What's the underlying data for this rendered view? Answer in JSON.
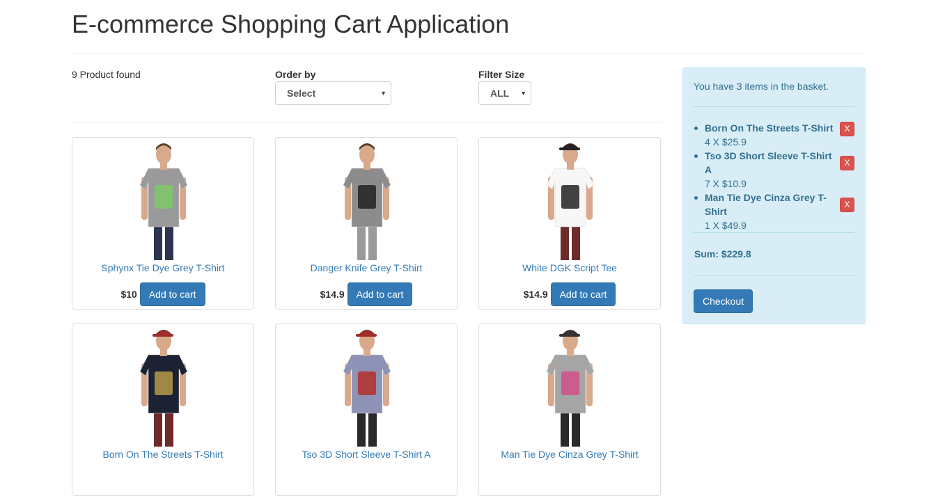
{
  "page": {
    "title": "E-commerce Shopping Cart Application"
  },
  "filters": {
    "count_text": "9 Product found",
    "order_label": "Order by",
    "order_value": "Select",
    "size_label": "Filter Size",
    "size_value": "ALL"
  },
  "products": [
    {
      "name": "Sphynx Tie Dye Grey T-Shirt",
      "price": "$10",
      "button": "Add to cart",
      "shirt": "#9a9a9a",
      "pants": "#2b3550",
      "hat": "",
      "print": "#7cc96a"
    },
    {
      "name": "Danger Knife Grey T-Shirt",
      "price": "$14.9",
      "button": "Add to cart",
      "shirt": "#8c8c8c",
      "pants": "#9a9a9a",
      "hat": "",
      "print": "#222222"
    },
    {
      "name": "White DGK Script Tee",
      "price": "$14.9",
      "button": "Add to cart",
      "shirt": "#f7f7f7",
      "pants": "#6e2b2b",
      "hat": "#222222",
      "print": "#222222"
    },
    {
      "name": "Born On The Streets T-Shirt",
      "price": "",
      "button": "",
      "shirt": "#1c2233",
      "pants": "#6e2b2b",
      "hat": "#a02b2b",
      "print": "#b59a4a"
    },
    {
      "name": "Tso 3D Short Sleeve T-Shirt A",
      "price": "",
      "button": "",
      "shirt": "#8e92b6",
      "pants": "#2a2a2a",
      "hat": "#a02b2b",
      "print": "#b3302b"
    },
    {
      "name": "Man Tie Dye Cinza Grey T-Shirt",
      "price": "",
      "button": "",
      "shirt": "#a5a5a5",
      "pants": "#2a2a2a",
      "hat": "#333333",
      "print": "#d0508a"
    }
  ],
  "cart": {
    "header": "You have 3 items in the basket.",
    "items": [
      {
        "name": "Born On The Streets T-Shirt",
        "qty": "4 X $25.9",
        "remove": "X"
      },
      {
        "name": "Tso 3D Short Sleeve T-Shirt A",
        "qty": "7 X $10.9",
        "remove": "X"
      },
      {
        "name": "Man Tie Dye Cinza Grey T-Shirt",
        "qty": "1 X $49.9",
        "remove": "X"
      }
    ],
    "sum": "Sum: $229.8",
    "checkout": "Checkout"
  },
  "colors": {
    "primary": "#337ab7",
    "danger": "#d9534f",
    "info_bg": "#d9edf7",
    "info_text": "#31708f"
  }
}
